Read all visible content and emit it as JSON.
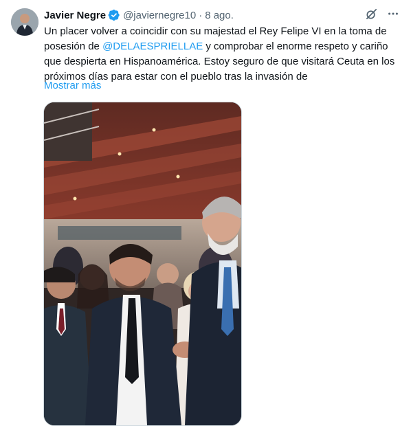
{
  "author": {
    "name": "Javier Negre",
    "handle": "@javiernegre10",
    "separator": "·",
    "date": "8 ago."
  },
  "tweet": {
    "text_before": "Un placer volver a coincidir con su majestad el Rey Felipe VI en la toma de posesión de ",
    "mention": "@DELAESPRIELLAE",
    "text_after": " y comprobar el enorme respeto y cariño que despierta en Hispanoamérica. Estoy seguro de que visitará Ceuta en los próximos días para estar con el pueblo tras la invasión de",
    "show_more": "Mostrar más"
  },
  "icons": {
    "verified": "verified-badge-icon",
    "grok": "grok-icon",
    "more": "more-options-icon"
  },
  "colors": {
    "link": "#1d9bf0",
    "secondary_text": "#536471",
    "primary_text": "#0f1419"
  }
}
